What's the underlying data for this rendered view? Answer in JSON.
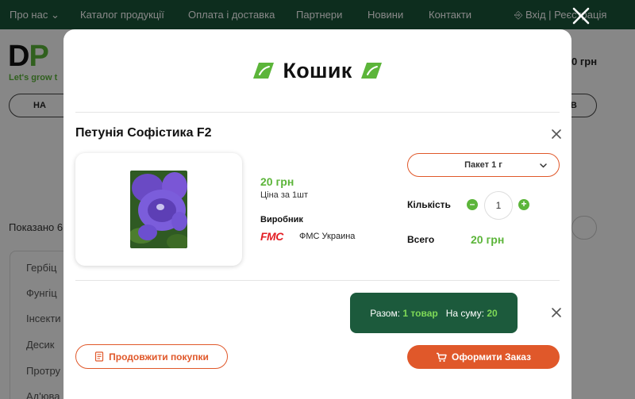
{
  "top_nav": {
    "items": [
      "Про нас",
      "Каталог продукції",
      "Оплата і доставка",
      "Партнери",
      "Новини",
      "Контакти"
    ],
    "login": "Вхід | Реєстрація"
  },
  "background": {
    "logo_text": "DP",
    "slogan": "Let's grow t",
    "pill_left": "НА",
    "pill_right": "У В",
    "price": "0 грн",
    "count_text": "Показано 6",
    "sidebar": [
      "Гербіц",
      "Фунгіц",
      "Інсекти",
      "Десик",
      "Протру",
      "Ад'юва"
    ]
  },
  "modal": {
    "title": "Кошик",
    "product": {
      "name": "Петунія Софістика F2",
      "price": "20 грн",
      "price_note": "Ціна за 1шт",
      "maker_label": "Виробник",
      "maker_logo": "FMC",
      "maker_name": "ФМС Украина",
      "pack": "Пакет 1 г",
      "qty_label": "Кількість",
      "qty": "1",
      "total_label": "Всего",
      "total": "20 грн"
    },
    "summary": {
      "prefix": "Разом:",
      "items": "1 товар",
      "sum_label": "На суму:",
      "sum": "20"
    },
    "buttons": {
      "continue": "Продовжити покупки",
      "order": "Оформити Заказ"
    }
  },
  "colors": {
    "brand_green": "#5cb53a",
    "dark_green": "#1c5a3c",
    "accent_orange": "#e0582a"
  }
}
